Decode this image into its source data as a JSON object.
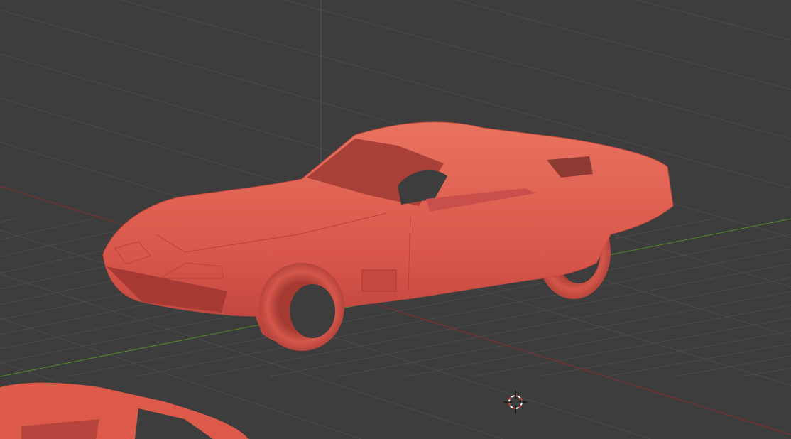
{
  "viewport": {
    "name": "3D Viewport",
    "background_color": "#3d3d3d",
    "grid_color": "#4a4a4a",
    "x_axis_color": "#8b2b2b",
    "y_axis_color": "#4f8a2a",
    "z_axis_color": "#4d5a6e",
    "model_color": "#dd5a4a",
    "cursor_icon": "3d-cursor-icon"
  }
}
